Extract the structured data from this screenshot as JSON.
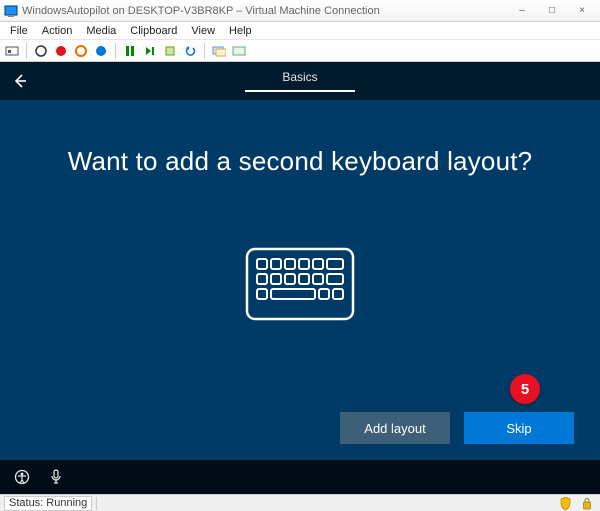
{
  "window": {
    "title": "WindowsAutopilot on DESKTOP-V3BR8KP – Virtual Machine Connection",
    "controls": {
      "minimize": "–",
      "maximize": "□",
      "close": "×"
    }
  },
  "menu": {
    "items": [
      "File",
      "Action",
      "Media",
      "Clipboard",
      "View",
      "Help"
    ]
  },
  "toolbar": {
    "icons": [
      "ctrl-alt-del-icon",
      "start-icon",
      "turnoff-icon",
      "shutdown-icon",
      "save-icon",
      "pause-icon",
      "reset-icon",
      "checkpoint-icon",
      "revert-icon",
      "enhanced-icon",
      "share-icon"
    ]
  },
  "oobe": {
    "tab": "Basics",
    "headline": "Want to add a second keyboard layout?",
    "buttons": {
      "add": "Add layout",
      "skip": "Skip"
    },
    "callout": "5"
  },
  "status": {
    "text": "Status: Running"
  }
}
